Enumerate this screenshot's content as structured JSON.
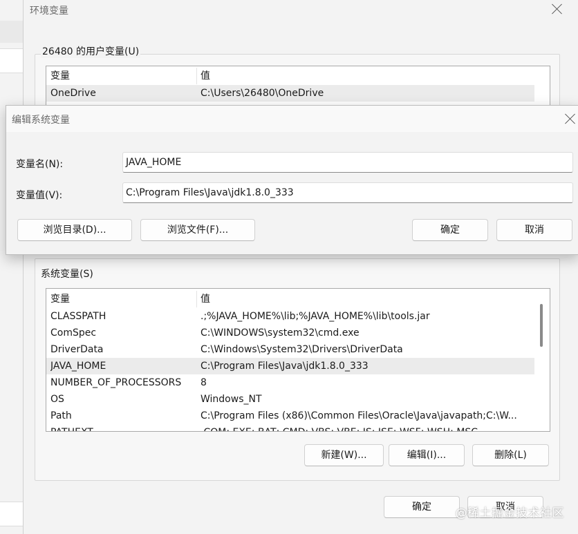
{
  "env_window": {
    "title": "环境变量",
    "user_group_label": "26480 的用户变量(U)",
    "user_vars": {
      "col_name": "变量",
      "col_value": "值",
      "rows": [
        {
          "name": "OneDrive",
          "value": "C:\\Users\\26480\\OneDrive"
        }
      ]
    },
    "system_group_label": "系统变量(S)",
    "system_vars": {
      "col_name": "变量",
      "col_value": "值",
      "rows": [
        {
          "name": "CLASSPATH",
          "value": ".;%JAVA_HOME%\\lib;%JAVA_HOME%\\lib\\tools.jar"
        },
        {
          "name": "ComSpec",
          "value": "C:\\WINDOWS\\system32\\cmd.exe"
        },
        {
          "name": "DriverData",
          "value": "C:\\Windows\\System32\\Drivers\\DriverData"
        },
        {
          "name": "JAVA_HOME",
          "value": "C:\\Program Files\\Java\\jdk1.8.0_333",
          "selected": true
        },
        {
          "name": "NUMBER_OF_PROCESSORS",
          "value": "8"
        },
        {
          "name": "OS",
          "value": "Windows_NT"
        },
        {
          "name": "Path",
          "value": "C:\\Program Files (x86)\\Common Files\\Oracle\\Java\\javapath;C:\\W..."
        },
        {
          "name": "PATHEXT",
          "value": ".COM;.EXE;.BAT;.CMD;.VBS;.VBE;.JS;.JSE;.WSF;.WSH;.MSC"
        }
      ]
    },
    "system_buttons": {
      "new": "新建(W)...",
      "edit": "编辑(I)...",
      "delete": "删除(L)"
    },
    "footer_buttons": {
      "ok": "确定",
      "cancel": "取消"
    }
  },
  "edit_dialog": {
    "title": "编辑系统变量",
    "name_label": "变量名(N):",
    "name_value": "JAVA_HOME",
    "value_label": "变量值(V):",
    "value_value": "C:\\Program Files\\Java\\jdk1.8.0_333",
    "buttons": {
      "browse_dir": "浏览目录(D)...",
      "browse_file": "浏览文件(F)...",
      "ok": "确定",
      "cancel": "取消"
    }
  },
  "watermark": "@稀土掘金技术社区"
}
